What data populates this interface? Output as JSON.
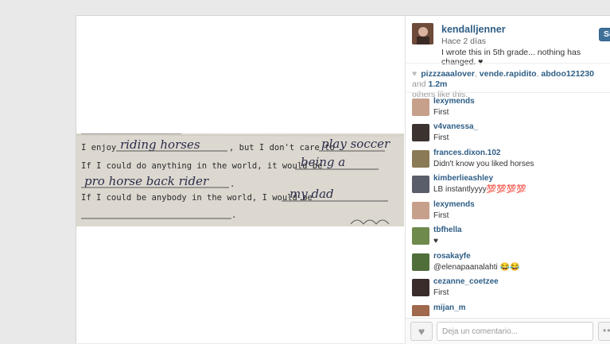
{
  "post": {
    "username": "kendalljenner",
    "time": "Hace 2 días",
    "caption": "I wrote this in 5th grade... nothing has changed. ♥",
    "follow_label": "Segu"
  },
  "photo": {
    "lines": [
      {
        "typed": "I enjoy",
        "written": "riding horses",
        "typed2": ", but I don't care to",
        "written2": "play soccer"
      },
      {
        "typed": "If I could do anything in the world, it would be",
        "written": "being a"
      },
      {
        "written": "pro horse back rider",
        "typed": "."
      },
      {
        "typed": "If I could be anybody in the world, I would be",
        "written": "my dad"
      },
      {
        "typed": "."
      }
    ]
  },
  "likes": {
    "users": [
      "pizzzaaalover",
      "vende.rapidito",
      "abdoo121230"
    ],
    "and_text": "and",
    "count": "1.2m",
    "suffix": "others like this."
  },
  "comments": [
    {
      "user": "lexymends",
      "text": "First",
      "avatar_color": "#c7a08c"
    },
    {
      "user": "v4vanessa_",
      "text": "First",
      "avatar_color": "#3b3330"
    },
    {
      "user": "frances.dixon.102",
      "text": "Didn't know you liked horses",
      "avatar_color": "#8a7a55"
    },
    {
      "user": "kimberlieashley",
      "text": "LB instantlyyyy💯💯💯💯",
      "avatar_color": "#5a5d6a"
    },
    {
      "user": "lexymends",
      "text": "First",
      "avatar_color": "#c7a08c"
    },
    {
      "user": "tbfhella",
      "text": "♥",
      "avatar_color": "#6f8a4d"
    },
    {
      "user": "rosakayfe",
      "text": "@elenapaanalahti 😂😂",
      "avatar_color": "#4f6e3a"
    },
    {
      "user": "cezanne_coetzee",
      "text": "First",
      "avatar_color": "#3a2c2a"
    },
    {
      "user": "mijan_m",
      "text": "",
      "avatar_color": "#a0684d"
    }
  ],
  "footer": {
    "comment_placeholder": "Deja un comentario...",
    "like_icon": "heart-icon",
    "more_icon": "ellipsis-icon",
    "more_label": "••"
  },
  "colors": {
    "link": "#2e5e86",
    "follow_button": "#3f729b"
  }
}
